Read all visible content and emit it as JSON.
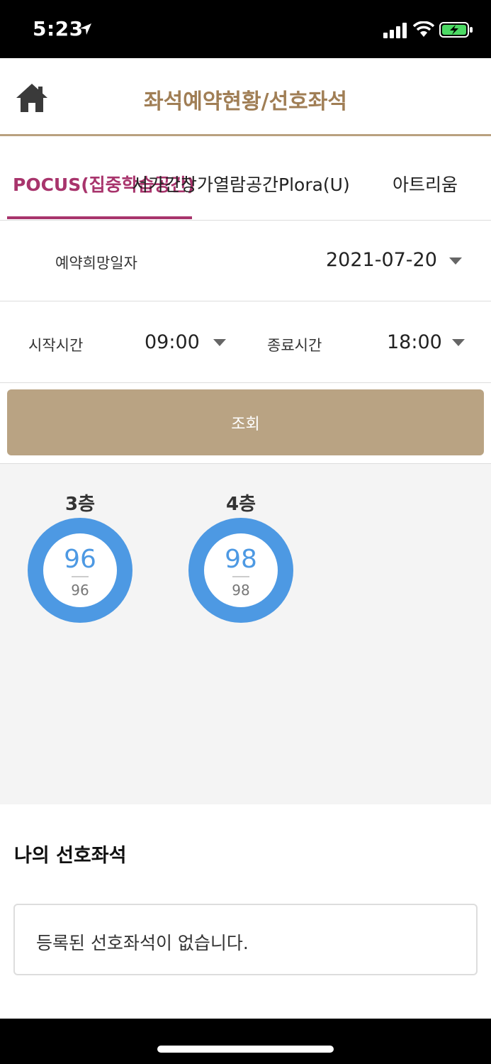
{
  "status_bar": {
    "time": "5:23"
  },
  "header": {
    "title": "좌석예약현황/선호좌석"
  },
  "tabs": [
    {
      "label": "POCUS(집중학습공간)",
      "active": true
    },
    {
      "label": "서가간창가열람공간Plora(U)",
      "active": false
    },
    {
      "label": "아트리움",
      "active": false
    }
  ],
  "date_row": {
    "label": "예약희망일자",
    "value": "2021-07-20"
  },
  "time_row": {
    "start_label": "시작시간",
    "start_value": "09:00",
    "end_label": "종료시간",
    "end_value": "18:00"
  },
  "search_button": {
    "label": "조회"
  },
  "floors": [
    {
      "name": "3층",
      "available": "96",
      "total": "96"
    },
    {
      "name": "4층",
      "available": "98",
      "total": "98"
    }
  ],
  "preferred": {
    "title": "나의 선호좌석",
    "empty_message": "등록된 선호좌석이 없습니다."
  },
  "colors": {
    "accent_brown": "#a07e55",
    "tab_active": "#a8346c",
    "ring_blue": "#4d99e3",
    "button_tan": "#b9a383"
  }
}
